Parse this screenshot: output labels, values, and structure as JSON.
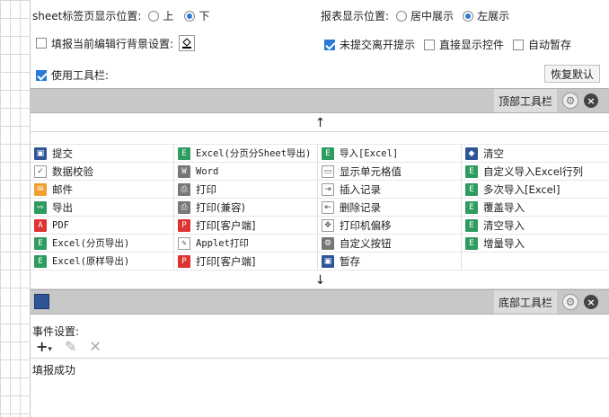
{
  "sheet_position": {
    "label": "sheet标签页显示位置:",
    "options": [
      "上",
      "下"
    ],
    "selected": "下"
  },
  "report_position": {
    "label": "报表显示位置:",
    "options": [
      "居中展示",
      "左展示"
    ],
    "selected": "左展示"
  },
  "fill_bg_label": "填报当前编辑行背景设置:",
  "unsubmitted_tip": "未提交离开提示",
  "direct_display": "直接显示控件",
  "auto_save": "自动暂存",
  "use_toolbar": "使用工具栏:",
  "reset_label": "恢复默认",
  "top_toolbar_title": "顶部工具栏",
  "bottom_toolbar_title": "底部工具栏",
  "arrow_up": "↑",
  "arrow_down": "↓",
  "tools": [
    {
      "label": "提交",
      "icon": "save-icon",
      "color": "blue"
    },
    {
      "label": "Excel(分页分Sheet导出)",
      "icon": "excel-icon",
      "color": "green",
      "mono": true
    },
    {
      "label": "导入[Excel]",
      "icon": "excel-icon",
      "color": "green",
      "mono": true
    },
    {
      "label": "清空",
      "icon": "eraser-icon",
      "color": "blue"
    },
    {
      "label": "数据校验",
      "icon": "check-icon",
      "color": "light"
    },
    {
      "label": "Word",
      "icon": "word-icon",
      "color": "grey",
      "mono": true
    },
    {
      "label": "显示单元格值",
      "icon": "cell-icon",
      "color": "light"
    },
    {
      "label": "自定义导入Excel行列",
      "icon": "excel-icon",
      "color": "green"
    },
    {
      "label": "邮件",
      "icon": "mail-icon",
      "color": "orange"
    },
    {
      "label": "打印",
      "icon": "printer-icon",
      "color": "grey"
    },
    {
      "label": "插入记录",
      "icon": "insert-icon",
      "color": "light"
    },
    {
      "label": "多次导入[Excel]",
      "icon": "excel-icon",
      "color": "green"
    },
    {
      "label": "导出",
      "icon": "export-icon",
      "color": "green"
    },
    {
      "label": "打印(兼容)",
      "icon": "printer-icon",
      "color": "grey"
    },
    {
      "label": "删除记录",
      "icon": "delete-record-icon",
      "color": "light"
    },
    {
      "label": "覆盖导入",
      "icon": "excel-icon",
      "color": "green"
    },
    {
      "label": "PDF",
      "icon": "pdf-icon",
      "color": "red",
      "mono": true
    },
    {
      "label": "打印[客户端]",
      "icon": "client-print-icon",
      "color": "red"
    },
    {
      "label": "打印机偏移",
      "icon": "move-icon",
      "color": "light"
    },
    {
      "label": "清空导入",
      "icon": "excel-icon",
      "color": "green"
    },
    {
      "label": "Excel(分页导出)",
      "icon": "excel-icon",
      "color": "green",
      "mono": true
    },
    {
      "label": "Applet打印",
      "icon": "applet-icon",
      "color": "light",
      "mono": true
    },
    {
      "label": "自定义按钮",
      "icon": "gear-icon",
      "color": "grey"
    },
    {
      "label": "增量导入",
      "icon": "excel-icon",
      "color": "green"
    },
    {
      "label": "Excel(原样导出)",
      "icon": "excel-icon",
      "color": "green",
      "mono": true
    },
    {
      "label": "打印[客户端]",
      "icon": "pdf-print-icon",
      "color": "red"
    },
    {
      "label": "暂存",
      "icon": "save-icon",
      "color": "blue"
    },
    {
      "label": "",
      "icon": "",
      "color": ""
    }
  ],
  "event_settings_label": "事件设置:",
  "event_items": [
    "填报成功"
  ]
}
